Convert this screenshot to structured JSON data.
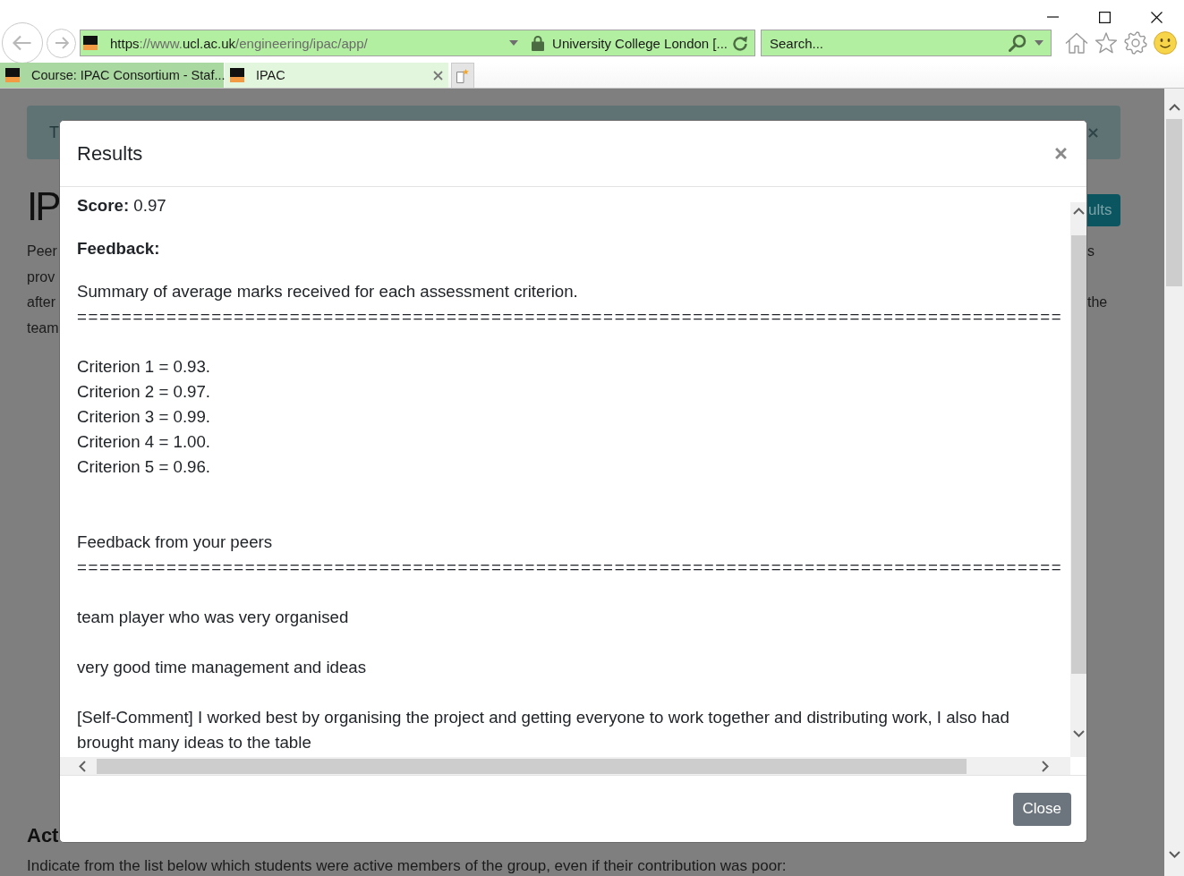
{
  "browser": {
    "address_bar": {
      "url": [
        {
          "text": "https",
          "highlighted": true
        },
        {
          "text": "://www.",
          "highlighted": false
        },
        {
          "text": "ucl.ac.uk",
          "highlighted": true
        },
        {
          "text": "/engineering/ipac/app/",
          "highlighted": false
        }
      ],
      "site_identity": "University College London [..."
    },
    "search": {
      "placeholder": "Search..."
    },
    "tabs": [
      {
        "label": "Course: IPAC Consortium - Staf...",
        "selected": false
      },
      {
        "label": "IPAC",
        "selected": true
      }
    ]
  },
  "page": {
    "alert": {
      "text": "T"
    },
    "heading": "IP",
    "action_button": "ults",
    "intro_lines": [
      {
        "left": "Peer",
        "right": "s"
      },
      {
        "left": "prov"
      },
      {
        "left": "after",
        "right": "the"
      },
      {
        "left": "team"
      }
    ],
    "section_heading": "Act",
    "instruction": "Indicate from the list below which students were active members of the group, even if their contribution was poor:"
  },
  "modal": {
    "title": "Results",
    "score": "**Score:** 0.97",
    "feedback_label": "Feedback:",
    "sections": [
      {
        "kind": "list",
        "heading": "Summary of average marks received for each assessment criterion.",
        "rule": "========================================================================================",
        "items": [
          "Criterion 1 = 0.93.",
          "Criterion 2 = 0.97.",
          "Criterion 3 = 0.99.",
          "Criterion 4 = 1.00.",
          "Criterion 5 = 0.96."
        ]
      },
      {
        "kind": "comments",
        "heading": "Feedback from your peers",
        "rule": "========================================================================================",
        "items": [
          "team player who was very organised",
          "very good time management and ideas",
          "[Self-Comment] I worked best by organising the project and getting everyone to work together and distributing work, I also had brought many ideas to the table"
        ]
      }
    ],
    "buttons": [
      "Close"
    ]
  }
}
